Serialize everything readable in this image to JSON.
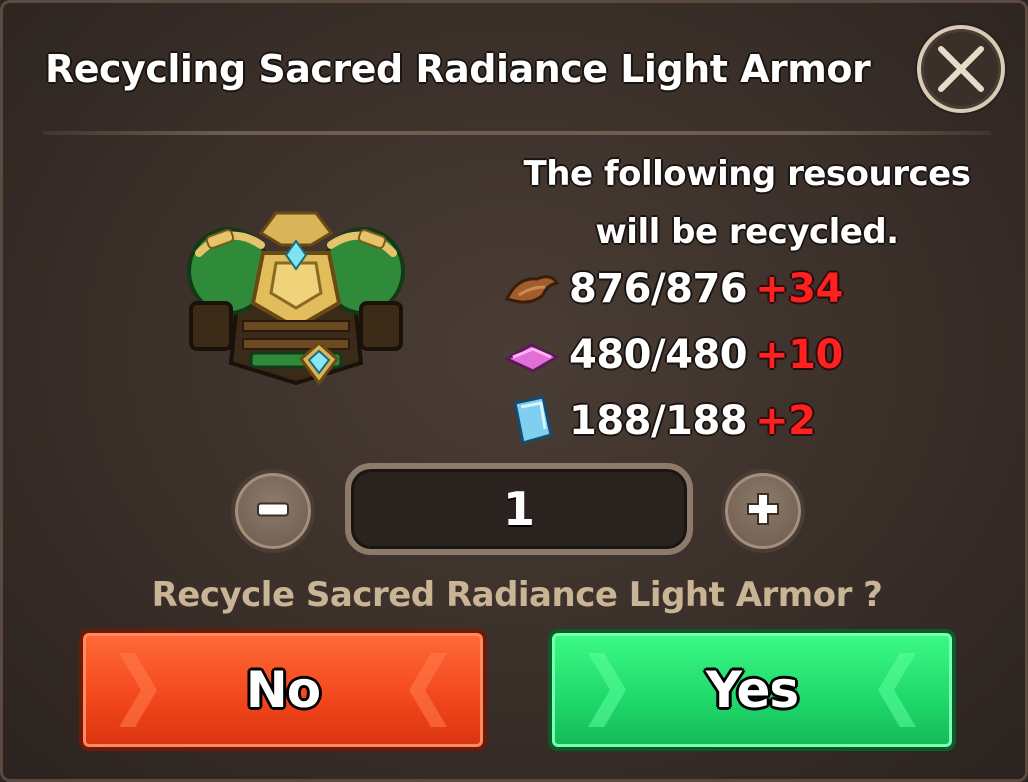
{
  "dialog": {
    "title": "Recycling Sacred Radiance Light Armor",
    "close_icon": "close-icon"
  },
  "item": {
    "icon": "armor-icon"
  },
  "resources": {
    "heading": "The following resources will be recycled.",
    "rows": [
      {
        "icon": "leather-icon",
        "amount": "876/876",
        "gain": "+34"
      },
      {
        "icon": "silk-icon",
        "amount": "480/480",
        "gain": "+10"
      },
      {
        "icon": "crystal-icon",
        "amount": "188/188",
        "gain": "+2"
      }
    ]
  },
  "quantity": {
    "value": "1",
    "minus_icon": "minus-icon",
    "plus_icon": "plus-icon"
  },
  "prompt": "Recycle Sacred Radiance Light Armor ?",
  "buttons": {
    "no": "No",
    "yes": "Yes"
  },
  "colors": {
    "gain": "#ff2020",
    "no_button": "#f2461c",
    "yes_button": "#1ed86a",
    "prompt_text": "#c9b496"
  }
}
